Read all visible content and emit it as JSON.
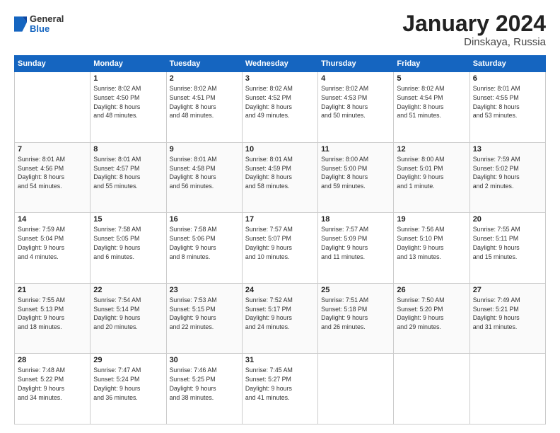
{
  "logo": {
    "general": "General",
    "blue": "Blue"
  },
  "title": "January 2024",
  "subtitle": "Dinskaya, Russia",
  "days_of_week": [
    "Sunday",
    "Monday",
    "Tuesday",
    "Wednesday",
    "Thursday",
    "Friday",
    "Saturday"
  ],
  "weeks": [
    [
      {
        "day": "",
        "info": ""
      },
      {
        "day": "1",
        "info": "Sunrise: 8:02 AM\nSunset: 4:50 PM\nDaylight: 8 hours\nand 48 minutes."
      },
      {
        "day": "2",
        "info": "Sunrise: 8:02 AM\nSunset: 4:51 PM\nDaylight: 8 hours\nand 48 minutes."
      },
      {
        "day": "3",
        "info": "Sunrise: 8:02 AM\nSunset: 4:52 PM\nDaylight: 8 hours\nand 49 minutes."
      },
      {
        "day": "4",
        "info": "Sunrise: 8:02 AM\nSunset: 4:53 PM\nDaylight: 8 hours\nand 50 minutes."
      },
      {
        "day": "5",
        "info": "Sunrise: 8:02 AM\nSunset: 4:54 PM\nDaylight: 8 hours\nand 51 minutes."
      },
      {
        "day": "6",
        "info": "Sunrise: 8:01 AM\nSunset: 4:55 PM\nDaylight: 8 hours\nand 53 minutes."
      }
    ],
    [
      {
        "day": "7",
        "info": "Sunrise: 8:01 AM\nSunset: 4:56 PM\nDaylight: 8 hours\nand 54 minutes."
      },
      {
        "day": "8",
        "info": "Sunrise: 8:01 AM\nSunset: 4:57 PM\nDaylight: 8 hours\nand 55 minutes."
      },
      {
        "day": "9",
        "info": "Sunrise: 8:01 AM\nSunset: 4:58 PM\nDaylight: 8 hours\nand 56 minutes."
      },
      {
        "day": "10",
        "info": "Sunrise: 8:01 AM\nSunset: 4:59 PM\nDaylight: 8 hours\nand 58 minutes."
      },
      {
        "day": "11",
        "info": "Sunrise: 8:00 AM\nSunset: 5:00 PM\nDaylight: 8 hours\nand 59 minutes."
      },
      {
        "day": "12",
        "info": "Sunrise: 8:00 AM\nSunset: 5:01 PM\nDaylight: 9 hours\nand 1 minute."
      },
      {
        "day": "13",
        "info": "Sunrise: 7:59 AM\nSunset: 5:02 PM\nDaylight: 9 hours\nand 2 minutes."
      }
    ],
    [
      {
        "day": "14",
        "info": "Sunrise: 7:59 AM\nSunset: 5:04 PM\nDaylight: 9 hours\nand 4 minutes."
      },
      {
        "day": "15",
        "info": "Sunrise: 7:58 AM\nSunset: 5:05 PM\nDaylight: 9 hours\nand 6 minutes."
      },
      {
        "day": "16",
        "info": "Sunrise: 7:58 AM\nSunset: 5:06 PM\nDaylight: 9 hours\nand 8 minutes."
      },
      {
        "day": "17",
        "info": "Sunrise: 7:57 AM\nSunset: 5:07 PM\nDaylight: 9 hours\nand 10 minutes."
      },
      {
        "day": "18",
        "info": "Sunrise: 7:57 AM\nSunset: 5:09 PM\nDaylight: 9 hours\nand 11 minutes."
      },
      {
        "day": "19",
        "info": "Sunrise: 7:56 AM\nSunset: 5:10 PM\nDaylight: 9 hours\nand 13 minutes."
      },
      {
        "day": "20",
        "info": "Sunrise: 7:55 AM\nSunset: 5:11 PM\nDaylight: 9 hours\nand 15 minutes."
      }
    ],
    [
      {
        "day": "21",
        "info": "Sunrise: 7:55 AM\nSunset: 5:13 PM\nDaylight: 9 hours\nand 18 minutes."
      },
      {
        "day": "22",
        "info": "Sunrise: 7:54 AM\nSunset: 5:14 PM\nDaylight: 9 hours\nand 20 minutes."
      },
      {
        "day": "23",
        "info": "Sunrise: 7:53 AM\nSunset: 5:15 PM\nDaylight: 9 hours\nand 22 minutes."
      },
      {
        "day": "24",
        "info": "Sunrise: 7:52 AM\nSunset: 5:17 PM\nDaylight: 9 hours\nand 24 minutes."
      },
      {
        "day": "25",
        "info": "Sunrise: 7:51 AM\nSunset: 5:18 PM\nDaylight: 9 hours\nand 26 minutes."
      },
      {
        "day": "26",
        "info": "Sunrise: 7:50 AM\nSunset: 5:20 PM\nDaylight: 9 hours\nand 29 minutes."
      },
      {
        "day": "27",
        "info": "Sunrise: 7:49 AM\nSunset: 5:21 PM\nDaylight: 9 hours\nand 31 minutes."
      }
    ],
    [
      {
        "day": "28",
        "info": "Sunrise: 7:48 AM\nSunset: 5:22 PM\nDaylight: 9 hours\nand 34 minutes."
      },
      {
        "day": "29",
        "info": "Sunrise: 7:47 AM\nSunset: 5:24 PM\nDaylight: 9 hours\nand 36 minutes."
      },
      {
        "day": "30",
        "info": "Sunrise: 7:46 AM\nSunset: 5:25 PM\nDaylight: 9 hours\nand 38 minutes."
      },
      {
        "day": "31",
        "info": "Sunrise: 7:45 AM\nSunset: 5:27 PM\nDaylight: 9 hours\nand 41 minutes."
      },
      {
        "day": "",
        "info": ""
      },
      {
        "day": "",
        "info": ""
      },
      {
        "day": "",
        "info": ""
      }
    ]
  ]
}
